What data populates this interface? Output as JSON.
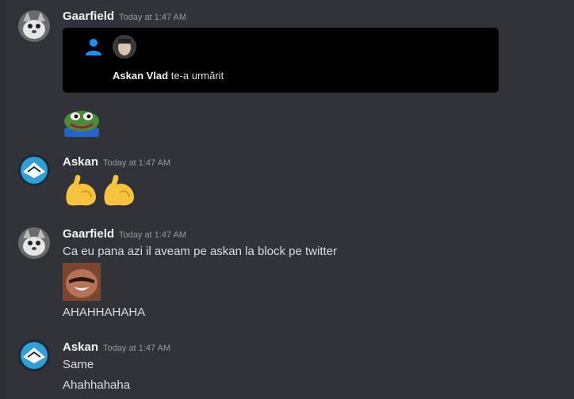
{
  "messages": [
    {
      "author": "Gaarfield",
      "timestamp": "Today at 1:47 AM",
      "embed": {
        "user": "Askan Vlad",
        "action": "te-a urmărit"
      }
    },
    {
      "author": "Askan",
      "timestamp": "Today at 1:47 AM"
    },
    {
      "author": "Gaarfield",
      "timestamp": "Today at 1:47 AM",
      "lines": [
        "Ca eu pana azi il aveam pe askan la block pe twitter",
        "AHAHHAHAHA"
      ]
    },
    {
      "author": "Askan",
      "timestamp": "Today at 1:47 AM",
      "lines": [
        "Same",
        "Ahahhahaha"
      ]
    }
  ],
  "colors": {
    "background": "#313338",
    "embed": "#000000",
    "accent": "#1e90ff"
  }
}
